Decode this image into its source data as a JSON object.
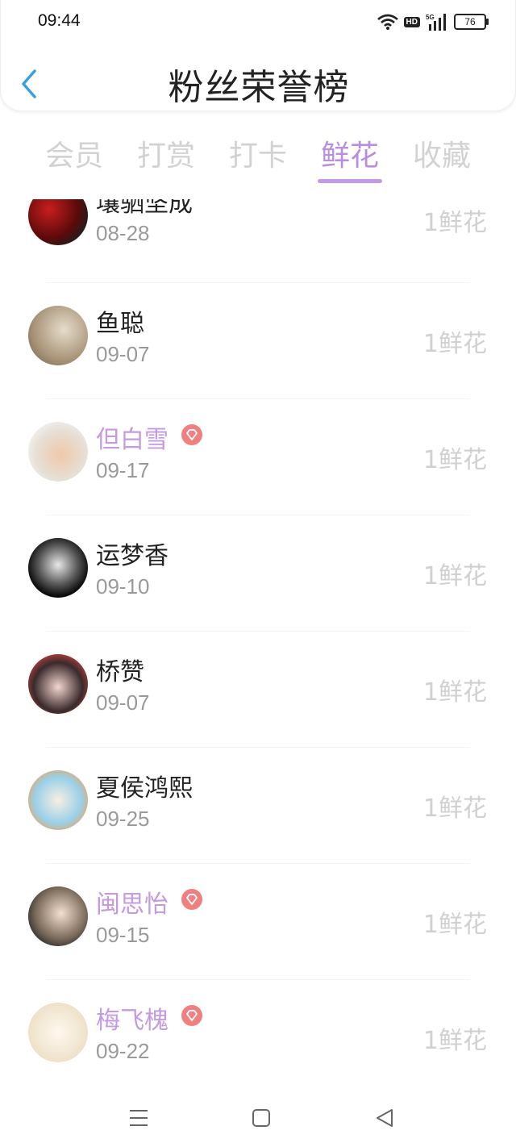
{
  "status_bar": {
    "time": "09:44",
    "hd_label": "HD",
    "network_label": "5G",
    "battery": "76",
    "icons": [
      "wifi-icon",
      "hd-icon",
      "signal-5g-icon",
      "battery-icon"
    ]
  },
  "header": {
    "title": "粉丝荣誉榜",
    "back_icon": "chevron-left-icon"
  },
  "tabs": [
    {
      "label": "会员",
      "active": false
    },
    {
      "label": "打赏",
      "active": false
    },
    {
      "label": "打卡",
      "active": false
    },
    {
      "label": "鲜花",
      "active": true
    },
    {
      "label": "收藏",
      "active": false
    }
  ],
  "fans": [
    {
      "name": "壤驷坚成",
      "date": "08-28",
      "count": "1鲜花",
      "vip": false
    },
    {
      "name": "鱼聪",
      "date": "09-07",
      "count": "1鲜花",
      "vip": false
    },
    {
      "name": "但白雪",
      "date": "09-17",
      "count": "1鲜花",
      "vip": true
    },
    {
      "name": "运梦香",
      "date": "09-10",
      "count": "1鲜花",
      "vip": false
    },
    {
      "name": "桥赞",
      "date": "09-07",
      "count": "1鲜花",
      "vip": false
    },
    {
      "name": "夏侯鸿熙",
      "date": "09-25",
      "count": "1鲜花",
      "vip": false
    },
    {
      "name": "闽思怡",
      "date": "09-15",
      "count": "1鲜花",
      "vip": true
    },
    {
      "name": "梅飞槐",
      "date": "09-22",
      "count": "1鲜花",
      "vip": true
    }
  ],
  "colors": {
    "accent": "#b98ee0",
    "vip_name": "#c49ae2",
    "vip_badge": "#f08080",
    "back_arrow": "#3aa0e6",
    "inactive_tab": "#d2d2d2"
  },
  "navbar": {
    "icons": [
      "menu-icon",
      "home-square-icon",
      "back-triangle-icon"
    ]
  }
}
